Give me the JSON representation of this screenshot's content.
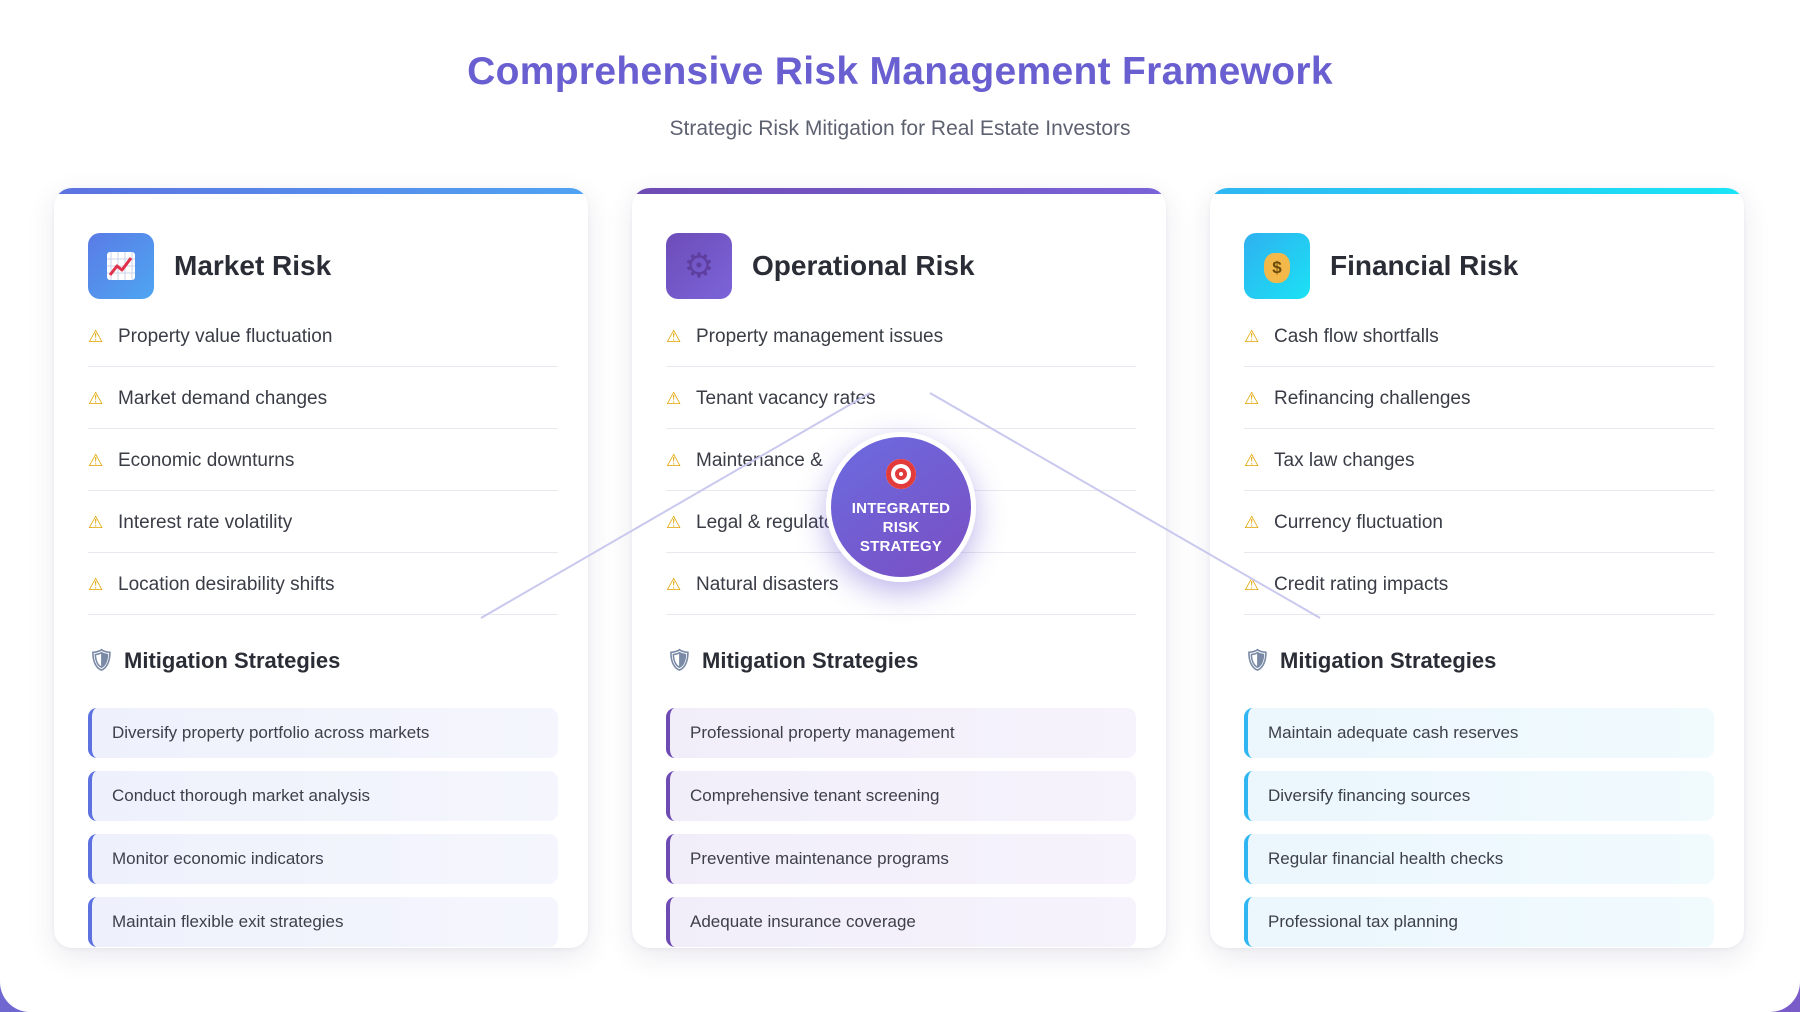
{
  "header": {
    "title": "Comprehensive Risk Management Framework",
    "subtitle": "Strategic Risk Mitigation for Real Estate Investors"
  },
  "center": {
    "label_line1": "INTEGRATED",
    "label_line2": "RISK",
    "label_line3": "STRATEGY",
    "icon": "target-icon"
  },
  "cards": [
    {
      "title": "Market Risk",
      "icon": "chart-increasing-icon",
      "risks": [
        "Property value fluctuation",
        "Market demand changes",
        "Economic downturns",
        "Interest rate volatility",
        "Location desirability shifts"
      ],
      "mitigation_title": "Mitigation Strategies",
      "mitigations": [
        "Diversify property portfolio across markets",
        "Conduct thorough market analysis",
        "Monitor economic indicators",
        "Maintain flexible exit strategies"
      ]
    },
    {
      "title": "Operational Risk",
      "icon": "gear-icon",
      "risks": [
        "Property management issues",
        "Tenant vacancy rates",
        "Maintenance &",
        "Legal & regulato",
        "Natural disasters"
      ],
      "mitigation_title": "Mitigation Strategies",
      "mitigations": [
        "Professional property management",
        "Comprehensive tenant screening",
        "Preventive maintenance programs",
        "Adequate insurance coverage"
      ]
    },
    {
      "title": "Financial Risk",
      "icon": "money-bag-icon",
      "risks": [
        "Cash flow shortfalls",
        "Refinancing challenges",
        "Tax law changes",
        "Currency fluctuation",
        "Credit rating impacts"
      ],
      "mitigation_title": "Mitigation Strategies",
      "mitigations": [
        "Maintain adequate cash reserves",
        "Diversify financing sources",
        "Regular financial health checks",
        "Professional tax planning"
      ]
    }
  ],
  "colors": {
    "title": "#6a5fd0",
    "market_accent": "#5d72e0",
    "operational_accent": "#6e4bb3",
    "financial_accent": "#2fb6f2",
    "warning": "#e2a400"
  }
}
